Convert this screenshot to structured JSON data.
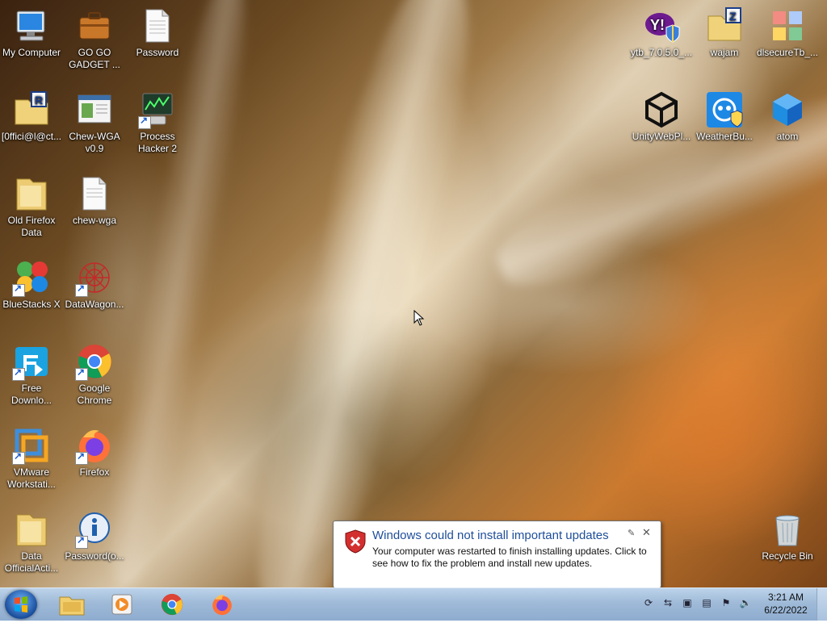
{
  "desktop": {
    "icons_left": [
      {
        "label": "My Computer",
        "icon": "computer-icon"
      },
      {
        "label": "GO GO GADGET ...",
        "icon": "briefcase-icon"
      },
      {
        "label": "Password",
        "icon": "text-file-icon"
      },
      {
        "label": "[0ffici@l@ct...",
        "icon": "folder-r-icon"
      },
      {
        "label": "Chew-WGA v0.9",
        "icon": "app-window-icon"
      },
      {
        "label": "Process Hacker 2",
        "icon": "process-hacker-icon"
      },
      {
        "label": "Old Firefox Data",
        "icon": "folder-icon"
      },
      {
        "label": "chew-wga",
        "icon": "text-file-icon"
      },
      {
        "label": "BlueStacks X",
        "icon": "bluestacks-icon"
      },
      {
        "label": "DataWagon...",
        "icon": "datawagon-icon"
      },
      {
        "label": "Free Downlo...",
        "icon": "free-download-icon"
      },
      {
        "label": "Google Chrome",
        "icon": "chrome-icon"
      },
      {
        "label": "VMware Workstati...",
        "icon": "vmware-icon"
      },
      {
        "label": "Firefox",
        "icon": "firefox-icon"
      },
      {
        "label": "Data OfficialActi...",
        "icon": "folder-icon"
      },
      {
        "label": "Password(o...",
        "icon": "info-icon"
      }
    ],
    "icons_right": [
      {
        "label": "ytb_7.0.5.0_...",
        "icon": "yahoo-icon"
      },
      {
        "label": "wajam",
        "icon": "folder-z-icon"
      },
      {
        "label": "dlsecureTb_...",
        "icon": "puzzle-icon"
      },
      {
        "label": "UnityWebPl...",
        "icon": "unity-icon"
      },
      {
        "label": "WeatherBu...",
        "icon": "weatherbug-icon"
      },
      {
        "label": "atom",
        "icon": "atom-icon"
      },
      {
        "label": "Recycle Bin",
        "icon": "recycle-bin-icon"
      }
    ]
  },
  "balloon": {
    "title": "Windows could not install important updates",
    "message": "Your computer was restarted to finish installing updates. Click to see how to fix the problem and install new updates.",
    "close": "✕",
    "pin": "✎"
  },
  "taskbar": {
    "pinned": [
      {
        "icon": "file-explorer-icon"
      },
      {
        "icon": "media-player-icon"
      },
      {
        "icon": "chrome-icon"
      },
      {
        "icon": "firefox-icon"
      }
    ],
    "tray": [
      "network-icon",
      "action-center-icon",
      "display-icon",
      "flag-icon",
      "volume-icon"
    ],
    "time": "3:21 AM",
    "date": "6/22/2022"
  }
}
